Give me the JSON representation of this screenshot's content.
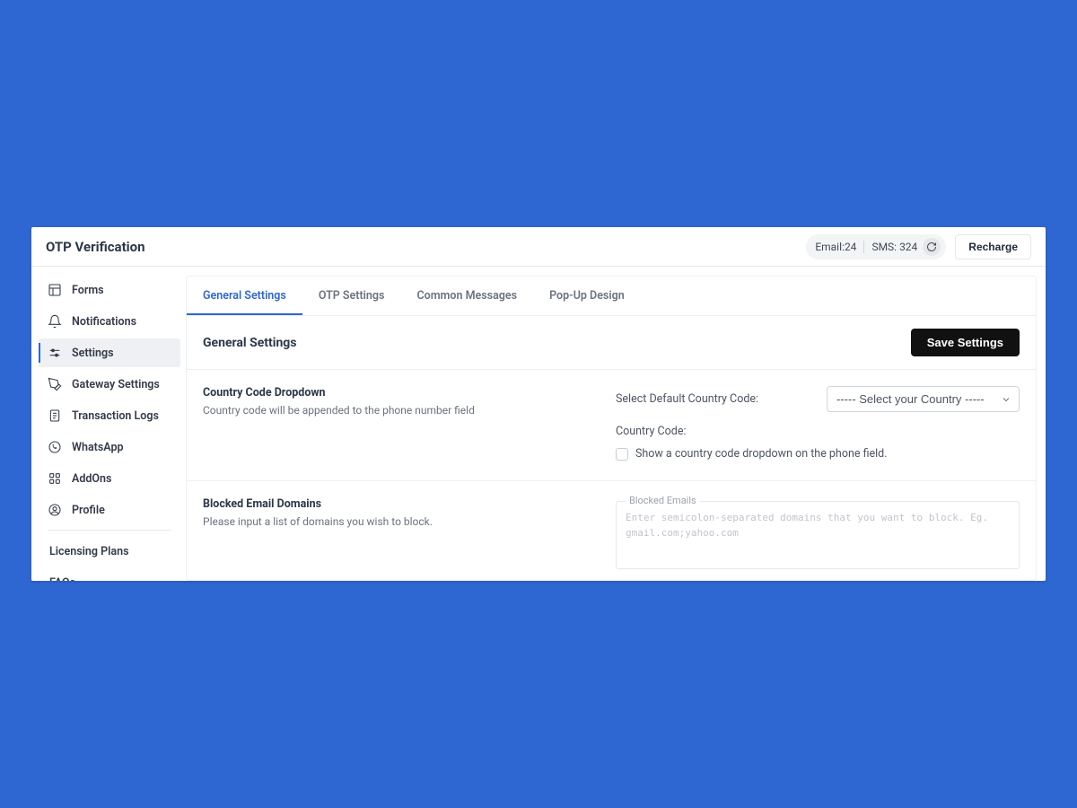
{
  "header": {
    "title": "OTP Verification",
    "email_label": "Email:",
    "email_count": "24",
    "sms_label": "SMS:",
    "sms_count": "324",
    "recharge_label": "Recharge"
  },
  "sidebar": {
    "items": [
      {
        "icon": "layout",
        "label": "Forms"
      },
      {
        "icon": "bell",
        "label": "Notifications"
      },
      {
        "icon": "sliders",
        "label": "Settings",
        "active": true
      },
      {
        "icon": "pen",
        "label": "Gateway Settings"
      },
      {
        "icon": "file",
        "label": "Transaction Logs"
      },
      {
        "icon": "whatsapp",
        "label": "WhatsApp"
      },
      {
        "icon": "grid",
        "label": "AddOns"
      },
      {
        "icon": "user",
        "label": "Profile"
      }
    ],
    "links": [
      {
        "label": "Licensing Plans"
      },
      {
        "label": "FAQs"
      }
    ]
  },
  "tabs": [
    {
      "label": "General Settings",
      "active": true
    },
    {
      "label": "OTP Settings"
    },
    {
      "label": "Common Messages"
    },
    {
      "label": "Pop-Up Design"
    }
  ],
  "panel": {
    "title": "General Settings",
    "save_label": "Save Settings",
    "sections": {
      "country": {
        "title": "Country Code Dropdown",
        "desc": "Country code will be appended to the phone number field",
        "select_label": "Select Default Country Code:",
        "select_value": "----- Select your Country -----",
        "code_label": "Country Code:",
        "checkbox_label": "Show a country code dropdown on the phone field."
      },
      "blocked": {
        "title": "Blocked Email Domains",
        "desc": "Please input a list of domains you wish to block.",
        "fieldset_legend": "Blocked Emails",
        "placeholder": "Enter semicolon-separated domains that you want to block. Eg. gmail.com;yahoo.com"
      }
    }
  }
}
